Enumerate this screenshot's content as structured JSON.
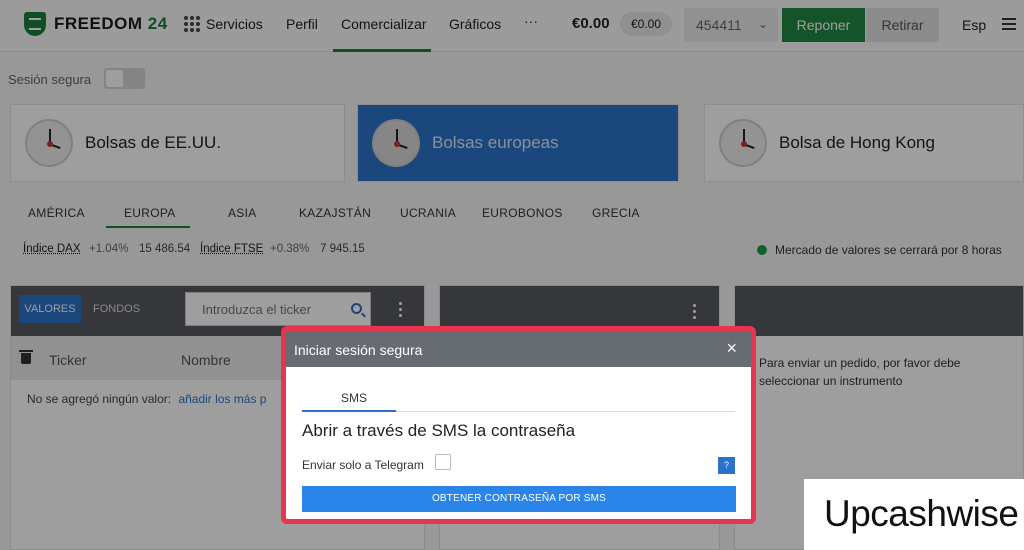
{
  "header": {
    "brand_word": "FREEDOM",
    "brand_num": "24",
    "nav": [
      "Servicios",
      "Perfil",
      "Comercializar",
      "Gráficos",
      "···"
    ],
    "balance": "€0.00",
    "balance_pill": "€0.00",
    "account": "454411",
    "deposit_label": "Reponer",
    "withdraw_label": "Retirar",
    "language": "Esp"
  },
  "secure_session_label": "Sesión segura",
  "exchanges": [
    "Bolsas de EE.UU.",
    "Bolsas europeas",
    "Bolsa de Hong Kong"
  ],
  "regions": [
    "AMÉRICA",
    "EUROPA",
    "ASIA",
    "KAZAJSTÁN",
    "UCRANIA",
    "EUROBONOS",
    "GRECIA"
  ],
  "indices": [
    {
      "name": "Índice DAX",
      "change": "+1.04%",
      "value": "15 486.54"
    },
    {
      "name": "Índice FTSE",
      "change": "+0.38%",
      "value": "7 945.15"
    }
  ],
  "market_status": "Mercado de valores se cerrará por 8 horas",
  "watchlist": {
    "tab_valores": "VALORES",
    "tab_fondos": "FONDOS",
    "ticker_placeholder": "Introduzca el ticker",
    "col_ticker": "Ticker",
    "col_nombre": "Nombre",
    "empty_text": "No se agregó ningún valor:",
    "empty_link": "añadir los más p"
  },
  "order_message": "Para enviar un pedido, por favor debe seleccionar un instrumento",
  "modal": {
    "title": "Iniciar sesión segura",
    "close": "×",
    "tab": "SMS",
    "heading": "Abrir a través de SMS la contraseña",
    "telegram_label": "Enviar solo a Telegram",
    "help": "?",
    "button": "OBTENER CONTRASEÑA POR SMS"
  },
  "watermark": "Upcashwise",
  "colors": {
    "brand_green": "#1a7f3c",
    "accent_blue": "#2b73c8",
    "modal_border": "#e8344f"
  }
}
